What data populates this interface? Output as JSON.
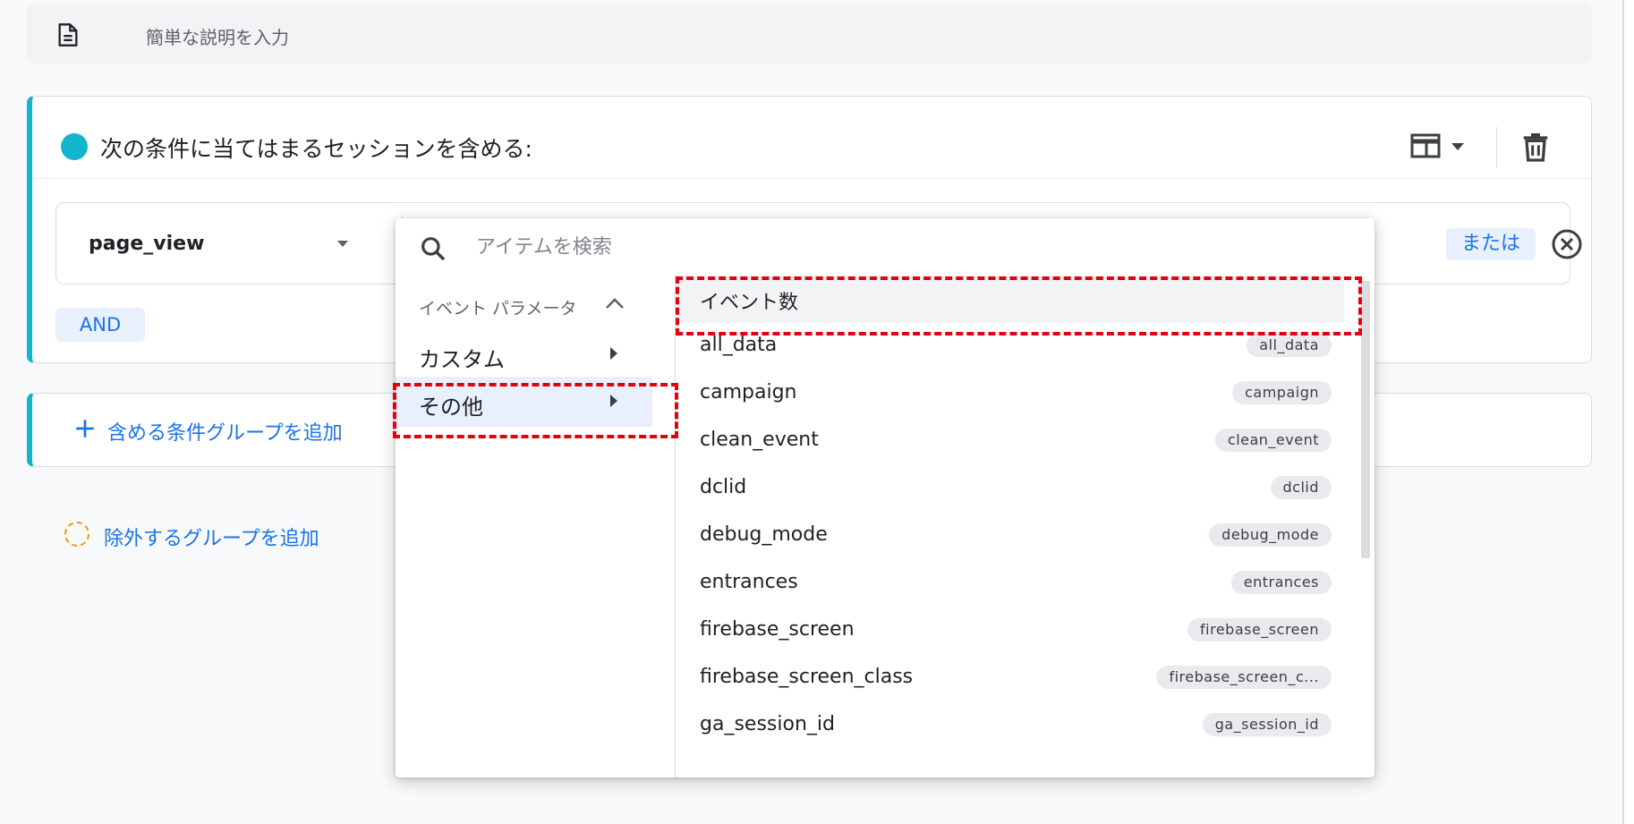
{
  "description": {
    "placeholder": "簡単な説明を入力"
  },
  "group": {
    "title": "次の条件に当てはまるセッションを含める:",
    "event_select_value": "page_view",
    "or_label": "または",
    "and_label": "AND"
  },
  "add_include_label": "含める条件グループを追加",
  "add_exclude_label": "除外するグループを追加",
  "dropdown": {
    "search_placeholder": "アイテムを検索",
    "section_label": "イベント パラメータ",
    "categories": [
      {
        "label": "カスタム",
        "selected": false
      },
      {
        "label": "その他",
        "selected": true
      }
    ],
    "items": [
      {
        "name": "イベント数",
        "tag": ""
      },
      {
        "name": "all_data",
        "tag": "all_data"
      },
      {
        "name": "campaign",
        "tag": "campaign"
      },
      {
        "name": "clean_event",
        "tag": "clean_event"
      },
      {
        "name": "dclid",
        "tag": "dclid"
      },
      {
        "name": "debug_mode",
        "tag": "debug_mode"
      },
      {
        "name": "entrances",
        "tag": "entrances"
      },
      {
        "name": "firebase_screen",
        "tag": "firebase_screen"
      },
      {
        "name": "firebase_screen_class",
        "tag": "firebase_screen_c..."
      },
      {
        "name": "ga_session_id",
        "tag": "ga_session_id"
      }
    ]
  },
  "colors": {
    "accent": "#12b5cb",
    "link": "#1a73e8",
    "highlight": "#e3000f"
  },
  "icons": [
    "document-icon",
    "layout-icon",
    "trash-icon",
    "clear-icon",
    "plus-icon",
    "search-icon",
    "chevron-up-icon",
    "arrow-right-icon"
  ]
}
